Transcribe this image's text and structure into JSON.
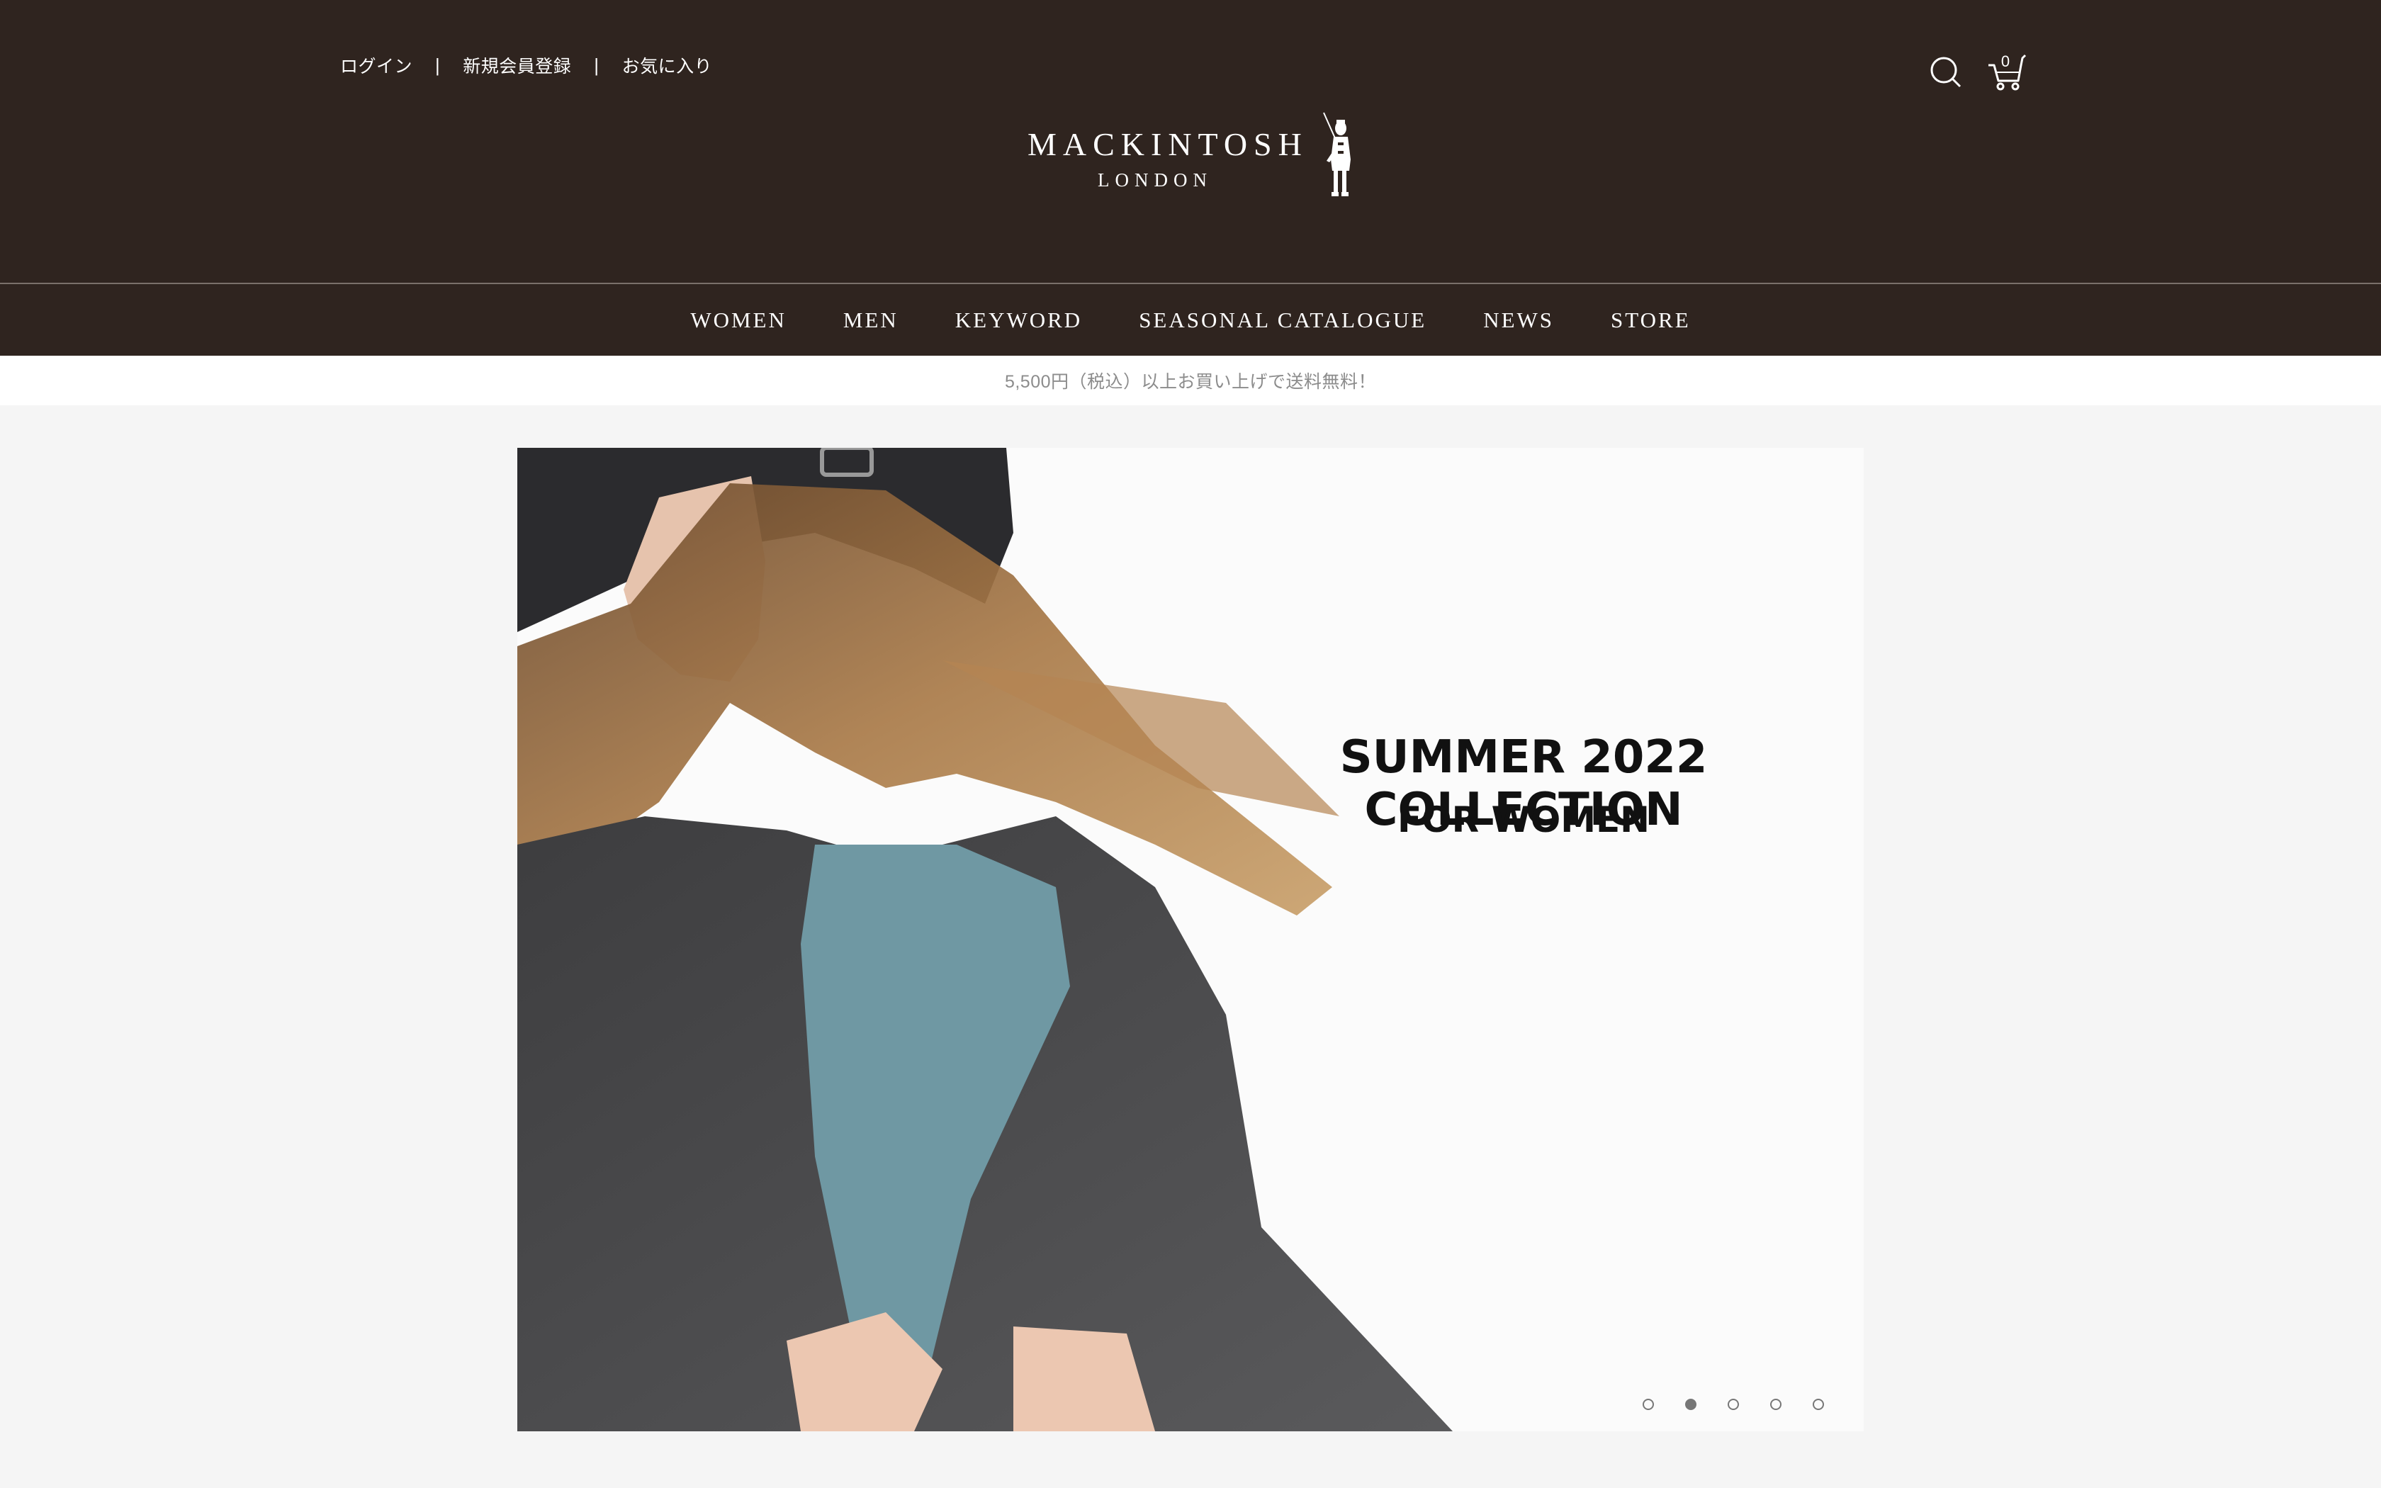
{
  "header": {
    "util_links": [
      {
        "label": "ログイン"
      },
      {
        "label": "新規会員登録"
      },
      {
        "label": "お気に入り"
      }
    ],
    "separator": "|",
    "cart_count": "0",
    "icons": {
      "search": "search-icon",
      "cart": "cart-icon"
    }
  },
  "logo": {
    "wordmark": "MACKINTOSH",
    "sub": "LONDON"
  },
  "nav": {
    "items": [
      {
        "label": "WOMEN"
      },
      {
        "label": "MEN"
      },
      {
        "label": "KEYWORD"
      },
      {
        "label": "SEASONAL CATALOGUE"
      },
      {
        "label": "NEWS"
      },
      {
        "label": "STORE"
      }
    ]
  },
  "shipping": {
    "notice": "5,500円（税込）以上お買い上げで送料無料！"
  },
  "hero": {
    "title": "SUMMER 2022 COLLECTION",
    "subtitle": "FOR WOMEN",
    "slide_count": 5,
    "active_slide": 2
  },
  "colors": {
    "header_bg": "#2f241f",
    "page_bg": "#f5f5f5",
    "shipping_text": "#8c8c8c"
  }
}
